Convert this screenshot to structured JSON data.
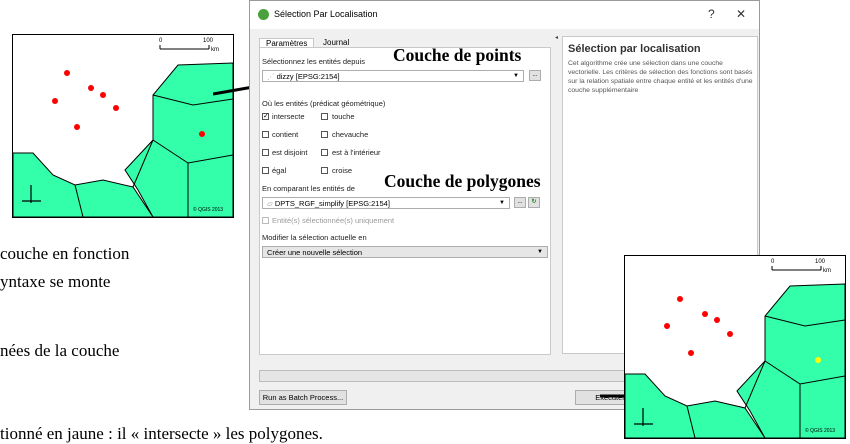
{
  "dialog": {
    "title": "Sélection Par Localisation",
    "help_button": "?",
    "close_button": "✕",
    "tabs": [
      "Paramètres",
      "Journal"
    ],
    "select_features_label": "Sélectionnez les entités depuis",
    "source_layer": "dizzy [EPSG:2154]",
    "predicate_label": "Où les entités (prédicat géométrique)",
    "predicates": [
      {
        "label": "intersecte",
        "checked": true
      },
      {
        "label": "touche",
        "checked": false
      },
      {
        "label": "contient",
        "checked": false
      },
      {
        "label": "chevauche",
        "checked": false
      },
      {
        "label": "est disjoint",
        "checked": false
      },
      {
        "label": "est à l'intérieur",
        "checked": false
      },
      {
        "label": "égal",
        "checked": false
      },
      {
        "label": "croise",
        "checked": false
      }
    ],
    "compare_label": "En comparant les entités de",
    "compare_layer": "DPTS_RGF_simplify [EPSG:2154]",
    "selected_only_label": "Entité(s) sélectionnée(s) uniquement",
    "modify_label": "Modifier la sélection actuelle en",
    "modify_value": "Créer une nouvelle sélection",
    "ellipsis": "...",
    "help_title": "Sélection par localisation",
    "help_text": "Cet algorithme crée une sélection dans une couche vectorielle. Les critères de sélection des fonctions sont basés sur la relation spatiale entre chaque entité et les entités d'une couche supplémentaire",
    "batch_button": "Run as Batch Process...",
    "run_button": "Exécuter"
  },
  "annotations": {
    "points_layer": "Couche de points",
    "polygons_layer": "Couche de polygones"
  },
  "map": {
    "scale_zero": "0",
    "scale_hundred": "100",
    "scale_unit": "km",
    "copyright": "© QGIS 2013"
  },
  "document_fragments": [
    "couche en fonction",
    "yntaxe se monte",
    "nées de la couche",
    "tionné en jaune : il « intersecte » les polygones."
  ],
  "colors": {
    "land": "#33ffaa",
    "points": "#ff0000",
    "selected_point": "#ffff00",
    "qgis_icon": "#4aa13b"
  }
}
